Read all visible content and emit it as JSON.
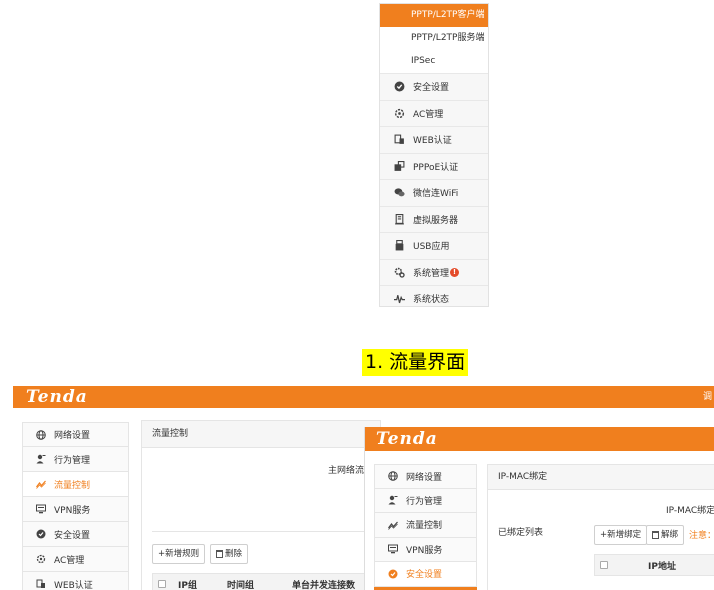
{
  "top_menu": {
    "sub_items": [
      "PPTP/L2TP客户端",
      "PPTP/L2TP服务端",
      "IPSec"
    ],
    "items": [
      {
        "label": "安全设置",
        "icon": "shield-icon"
      },
      {
        "label": "AC管理",
        "icon": "ac-manage-icon"
      },
      {
        "label": "WEB认证",
        "icon": "web-auth-icon"
      },
      {
        "label": "PPPoE认证",
        "icon": "pppoe-auth-icon"
      },
      {
        "label": "微信连WiFi",
        "icon": "wechat-icon"
      },
      {
        "label": "虚拟服务器",
        "icon": "virtual-server-icon"
      },
      {
        "label": "USB应用",
        "icon": "usb-icon"
      },
      {
        "label": "系统管理",
        "icon": "system-gear-icon"
      },
      {
        "label": "系统状态",
        "icon": "pulse-icon"
      }
    ],
    "badge": "!"
  },
  "caption": "1. 流量界面",
  "screen1": {
    "logo": "Tenda",
    "topbar_right": "调",
    "sidebar": [
      {
        "label": "网络设置",
        "icon": "globe-icon"
      },
      {
        "label": "行为管理",
        "icon": "user-behavior-icon"
      },
      {
        "label": "流量控制",
        "icon": "traffic-icon"
      },
      {
        "label": "VPN服务",
        "icon": "vpn-icon"
      },
      {
        "label": "安全设置",
        "icon": "shield-icon"
      },
      {
        "label": "AC管理",
        "icon": "ac-manage-icon"
      },
      {
        "label": "WEB认证",
        "icon": "web-auth-icon"
      }
    ],
    "panel_title": "流量控制",
    "main_text": "主网络流量",
    "add_button": "+新增规则",
    "delete_button": "删除",
    "table_headers": [
      "IP组",
      "时间组",
      "单台并发连接数"
    ]
  },
  "screen2": {
    "logo": "Tenda",
    "sidebar": [
      {
        "label": "网络设置",
        "icon": "globe-icon"
      },
      {
        "label": "行为管理",
        "icon": "user-behavior-icon"
      },
      {
        "label": "流量控制",
        "icon": "traffic-icon"
      },
      {
        "label": "VPN服务",
        "icon": "vpn-icon"
      },
      {
        "label": "安全设置",
        "icon": "shield-icon"
      }
    ],
    "panel_title": "IP-MAC绑定",
    "top_text": "IP-MAC绑定",
    "list_label": "已绑定列表",
    "add_button": "+新增绑定",
    "unbind_button": "解绑",
    "note": "注意：",
    "table_header": "IP地址"
  },
  "colors": {
    "accent": "#f07f1e",
    "caption_bg": "#ffff00"
  }
}
